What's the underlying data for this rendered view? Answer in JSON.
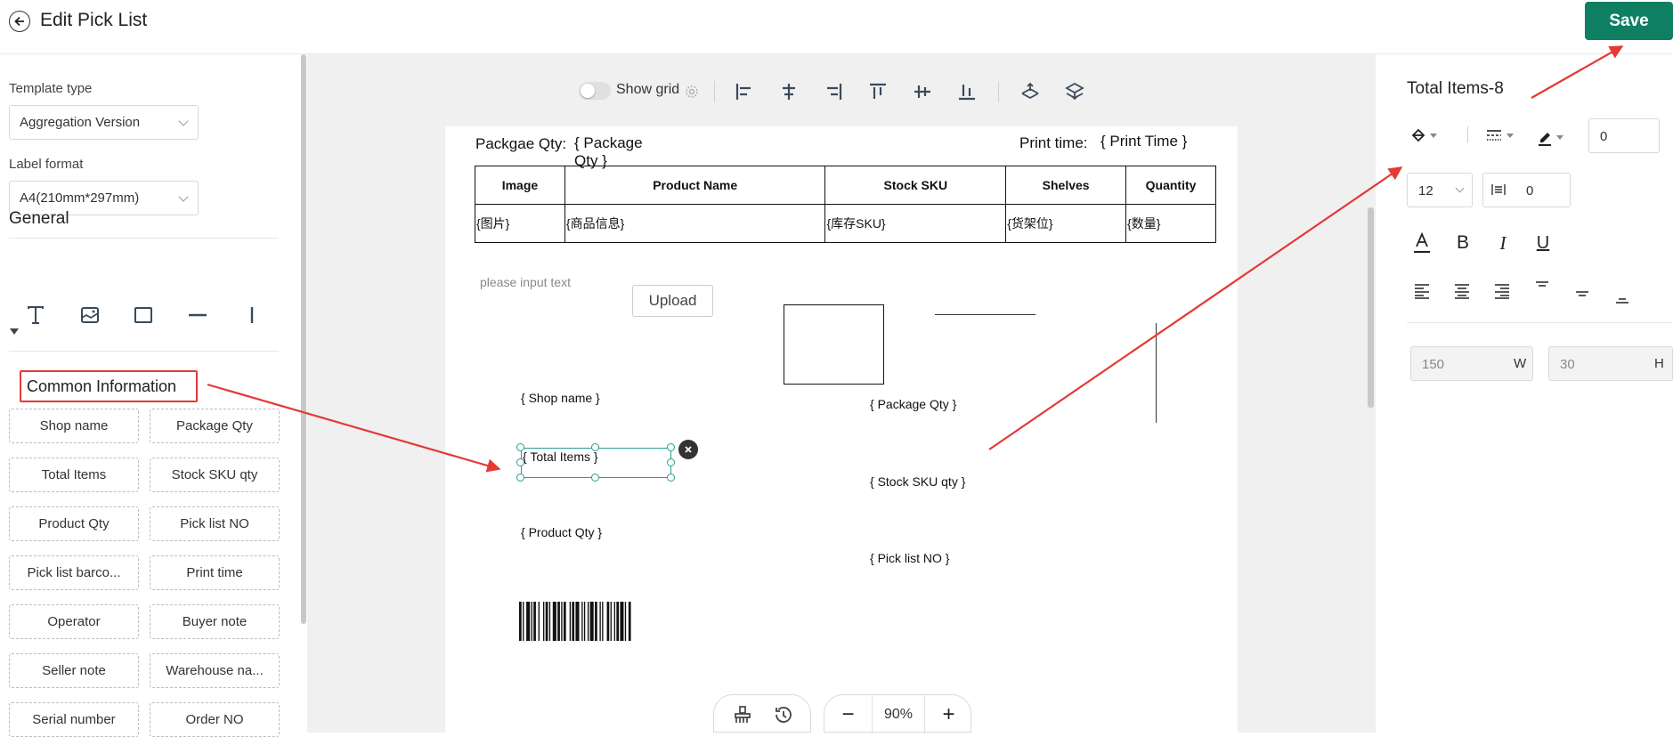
{
  "header": {
    "title": "Edit Pick List",
    "save_label": "Save"
  },
  "left": {
    "template_type_label": "Template type",
    "template_type_value": "Aggregation Version",
    "label_format_label": "Label format",
    "label_format_value": "A4(210mm*297mm)",
    "general_title": "General",
    "tools": [
      "text-tool-icon",
      "image-tool-icon",
      "rectangle-tool-icon",
      "horizontal-line-tool-icon",
      "vertical-line-tool-icon"
    ],
    "common_title": "Common Information",
    "chips": [
      "Shop name",
      "Package Qty",
      "Total Items",
      "Stock SKU qty",
      "Product Qty",
      "Pick list NO",
      "Pick list barco...",
      "Print time",
      "Operator",
      "Buyer note",
      "Seller note",
      "Warehouse na...",
      "Serial number",
      "Order NO"
    ]
  },
  "toolbar": {
    "show_grid_label": "Show grid",
    "show_grid_on": false
  },
  "paper": {
    "package_label": "Packgae Qty:",
    "package_value_line1": "{ Package",
    "package_value_line2": "Qty }",
    "print_time_label": "Print time:",
    "print_time_value": "{ Print Time }",
    "table_headers": [
      "Image",
      "Product Name",
      "Stock SKU",
      "Shelves",
      "Quantity"
    ],
    "table_row": [
      "{图片}",
      "{商品信息}",
      "{库存SKU}",
      "{货架位}",
      "{数量}"
    ],
    "placeholder_text": "please input text",
    "upload_label": "Upload",
    "fields": {
      "shop_name": "{ Shop name }",
      "package_qty": "{ Package Qty }",
      "total_items": "{ Total Items }",
      "stock_sku_qty": "{ Stock SKU qty }",
      "product_qty": "{ Product Qty }",
      "pick_list_no": "{ Pick list NO }"
    }
  },
  "zoom": {
    "value": "90%",
    "minus": "−",
    "plus": "+"
  },
  "right": {
    "title": "Total Items-8",
    "border_width": "0",
    "font_size": "12",
    "letter_spacing": "0",
    "width": "150",
    "width_unit": "W",
    "height": "30",
    "height_unit": "H"
  },
  "colors": {
    "accent": "#0e7f62",
    "annotation": "#e53935",
    "selection": "#2a9d8f"
  }
}
